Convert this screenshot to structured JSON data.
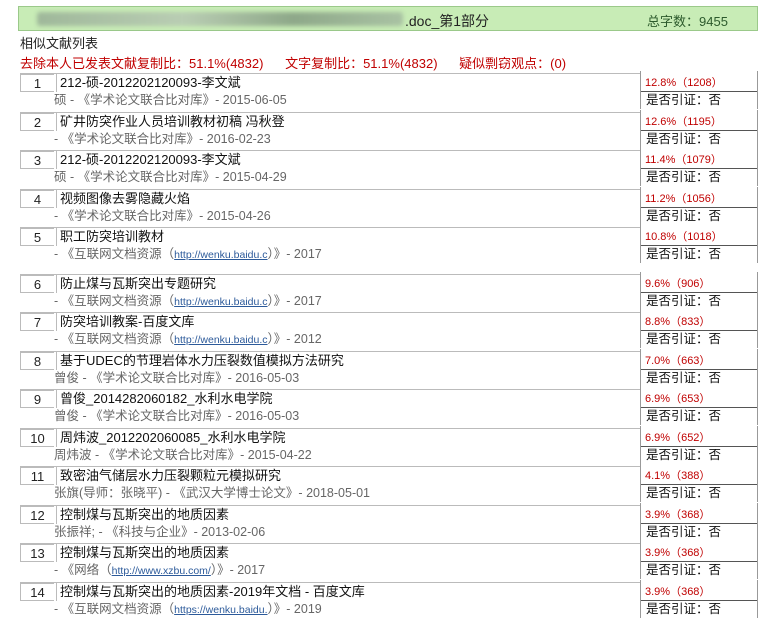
{
  "header": {
    "title": ".doc_第1部分",
    "word_count": "总字数：9455"
  },
  "subtitle": "相似文献列表",
  "stats": {
    "excl": "去除本人已发表文献复制比：51.1%(4832)",
    "text": "文字复制比：51.1%(4832)",
    "plag": "疑似剽窃观点：(0)"
  },
  "rows": [
    {
      "num": "1",
      "title": "212-硕-2012202120093-李文斌",
      "pre": "硕 - 《学术论文联合比对库》- 2015-06-05",
      "url": "",
      "post": "",
      "pct": "12.8%（1208）",
      "cite": "是否引证：否"
    },
    {
      "num": "2",
      "title": "矿井防突作业人员培训教材初稿 冯秋登",
      "pre": "- 《学术论文联合比对库》- 2016-02-23",
      "url": "",
      "post": "",
      "pct": "12.6%（1195）",
      "cite": "是否引证：否"
    },
    {
      "num": "3",
      "title": "212-硕-2012202120093-李文斌",
      "pre": "硕 - 《学术论文联合比对库》- 2015-04-29",
      "url": "",
      "post": "",
      "pct": "11.4%（1079）",
      "cite": "是否引证：否"
    },
    {
      "num": "4",
      "title": "视频图像去雾隐藏火焰",
      "pre": "- 《学术论文联合比对库》- 2015-04-26",
      "url": "",
      "post": "",
      "pct": "11.2%（1056）",
      "cite": "是否引证：否"
    },
    {
      "num": "5",
      "title": "职工防突培训教材",
      "pre": "- 《互联网文档资源（",
      "url": "http://wenku.baidu.c",
      "post": "）》- 2017",
      "pct": "10.8%（1018）",
      "cite": "是否引证：否"
    },
    {
      "num": "6",
      "title": "防止煤与瓦斯突出专题研究",
      "pre": "- 《互联网文档资源（",
      "url": "http://wenku.baidu.c",
      "post": "）》- 2017",
      "pct": "9.6%（906）",
      "cite": "是否引证：否"
    },
    {
      "num": "7",
      "title": "防突培训教案-百度文库",
      "pre": "- 《互联网文档资源（",
      "url": "http://wenku.baidu.c",
      "post": "）》- 2012",
      "pct": "8.8%（833）",
      "cite": "是否引证：否"
    },
    {
      "num": "8",
      "title": "基于UDEC的节理岩体水力压裂数值模拟方法研究",
      "pre": "曾俊 - 《学术论文联合比对库》- 2016-05-03",
      "url": "",
      "post": "",
      "pct": "7.0%（663）",
      "cite": "是否引证：否"
    },
    {
      "num": "9",
      "title": "曾俊_2014282060182_水利水电学院",
      "pre": "曾俊 - 《学术论文联合比对库》- 2016-05-03",
      "url": "",
      "post": "",
      "pct": "6.9%（653）",
      "cite": "是否引证：否"
    },
    {
      "num": "10",
      "title": "周炜波_2012202060085_水利水电学院",
      "pre": "周炜波 - 《学术论文联合比对库》- 2015-04-22",
      "url": "",
      "post": "",
      "pct": "6.9%（652）",
      "cite": "是否引证：否"
    },
    {
      "num": "11",
      "title": "致密油气储层水力压裂颗粒元模拟研究",
      "pre": "张旗(导师：张晓平) - 《武汉大学博士论文》- 2018-05-01",
      "url": "",
      "post": "",
      "pct": "4.1%（388）",
      "cite": "是否引证：否"
    },
    {
      "num": "12",
      "title": "控制煤与瓦斯突出的地质因素",
      "pre": "张振祥; - 《科技与企业》- 2013-02-06",
      "url": "",
      "post": "",
      "pct": "3.9%（368）",
      "cite": "是否引证：否"
    },
    {
      "num": "13",
      "title": "控制煤与瓦斯突出的地质因素",
      "pre": "- 《网络（",
      "url": "http://www.xzbu.com/",
      "post": "）》- 2017",
      "pct": "3.9%（368）",
      "cite": "是否引证：否"
    },
    {
      "num": "14",
      "title": "控制煤与瓦斯突出的地质因素-2019年文档 - 百度文库",
      "pre": "- 《互联网文档资源（",
      "url": "https://wenku.baidu.",
      "post": "）》- 2019",
      "pct": "3.9%（368）",
      "cite": "是否引证：否"
    }
  ]
}
